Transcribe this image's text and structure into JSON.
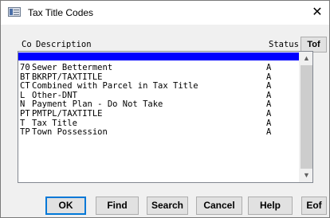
{
  "window": {
    "title": "Tax Title Codes",
    "close_glyph": "✕"
  },
  "columns": {
    "co": "Co",
    "description": "Description",
    "status": "Status"
  },
  "tof_label": "Tof",
  "rows": [
    {
      "code": "",
      "description": "",
      "status": "",
      "selected": true
    },
    {
      "code": "70",
      "description": "Sewer Betterment",
      "status": "A"
    },
    {
      "code": "BT",
      "description": "BKRPT/TAXTITLE",
      "status": "A"
    },
    {
      "code": "CT",
      "description": "Combined with Parcel in Tax Title",
      "status": "A"
    },
    {
      "code": "L",
      "description": "Other-DNT",
      "status": "A"
    },
    {
      "code": "N",
      "description": "Payment Plan - Do Not Take",
      "status": "A"
    },
    {
      "code": "PT",
      "description": "PMTPL/TAXTITLE",
      "status": "A"
    },
    {
      "code": "T",
      "description": "Tax Title",
      "status": "A"
    },
    {
      "code": "TP",
      "description": "Town Possession",
      "status": "A"
    }
  ],
  "scrollbar": {
    "up_glyph": "▲",
    "down_glyph": "▼"
  },
  "buttons": {
    "ok": "OK",
    "find": "Find",
    "search": "Search",
    "cancel": "Cancel",
    "help": "Help",
    "eof": "Eof"
  },
  "colors": {
    "selection": "#0000ff",
    "default_button_border": "#0078d7"
  }
}
